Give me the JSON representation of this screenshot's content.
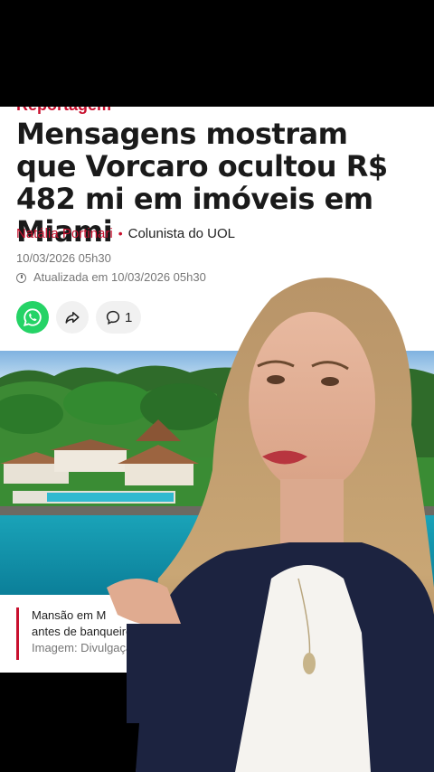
{
  "article": {
    "kicker": "Reportagem",
    "headline": "Mensagens mostram que Vorcaro ocultou R$ 482 mi em imóveis em Miami",
    "author": "Natália Portinari",
    "author_role": "Colunista do UOL",
    "published": "10/03/2026 05h30",
    "updated": "Atualizada em 10/03/2026 05h30",
    "comments_count": "1"
  },
  "caption": {
    "line1": "Mansão em M",
    "line2": "antes de banqueiro",
    "credit": "Imagem: Divulgação"
  },
  "colors": {
    "accent": "#c8102e",
    "whatsapp": "#25d366"
  },
  "icons": [
    "whatsapp-icon",
    "share-icon",
    "comment-icon",
    "clock-icon"
  ]
}
